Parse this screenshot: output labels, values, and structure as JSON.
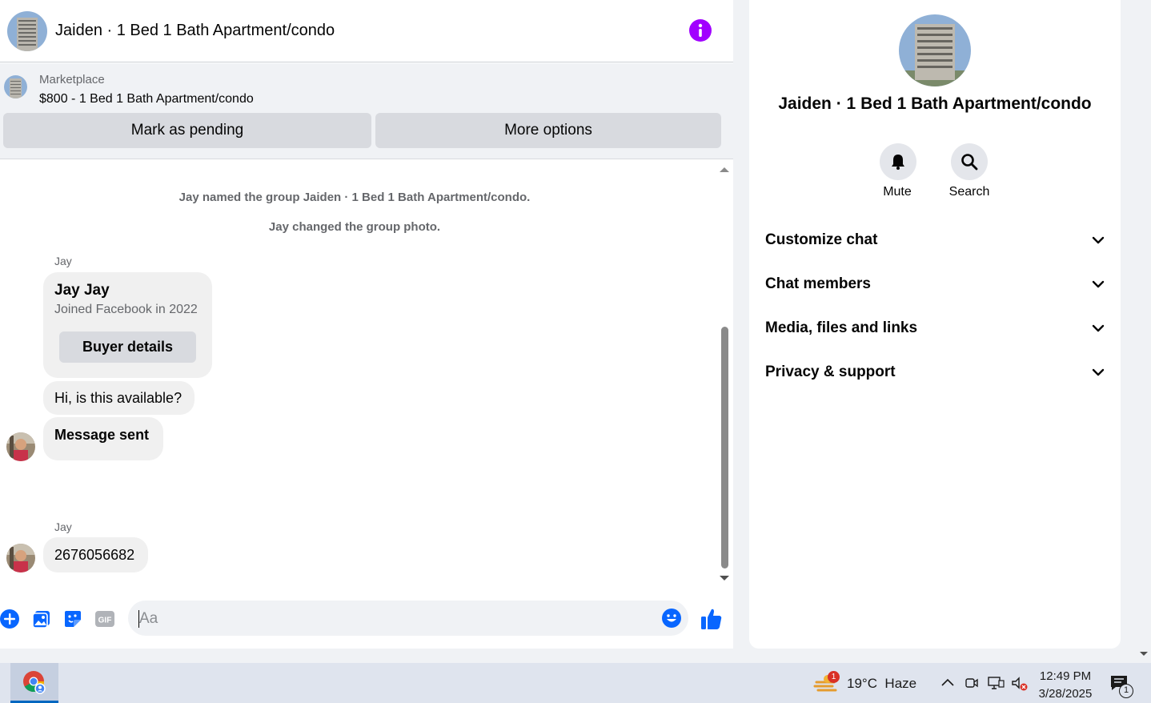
{
  "chat": {
    "title": "Jaiden · 1 Bed 1 Bath Apartment/condo",
    "listing_source": "Marketplace",
    "listing_title": "$800 - 1 Bed 1 Bath Apartment/condo",
    "mark_pending_label": "Mark as pending",
    "more_options_label": "More options",
    "system_messages": [
      "Jay named the group Jaiden · 1 Bed 1 Bath Apartment/condo.",
      "Jay changed the group photo."
    ],
    "sender_1": "Jay",
    "card_name": "Jay Jay",
    "card_sub": "Joined Facebook in 2022",
    "buyer_details_label": "Buyer details",
    "msg_available": "Hi, is this available?",
    "msg_sent": "Message sent",
    "sender_2": "Jay",
    "msg_phone": "2676056682",
    "input_placeholder": "Aa"
  },
  "details": {
    "name": "Jaiden · 1 Bed 1 Bath Apartment/condo",
    "mute_label": "Mute",
    "search_label": "Search",
    "sections": [
      "Customize chat",
      "Chat members",
      "Media, files and links",
      "Privacy & support"
    ]
  },
  "taskbar": {
    "weather_badge": "1",
    "weather": "19°C  Haze",
    "time": "12:49 PM",
    "date": "3/28/2025",
    "notification_badge": "1"
  },
  "colors": {
    "accent_purple": "#a100ff",
    "messenger_blue": "#0866ff"
  }
}
